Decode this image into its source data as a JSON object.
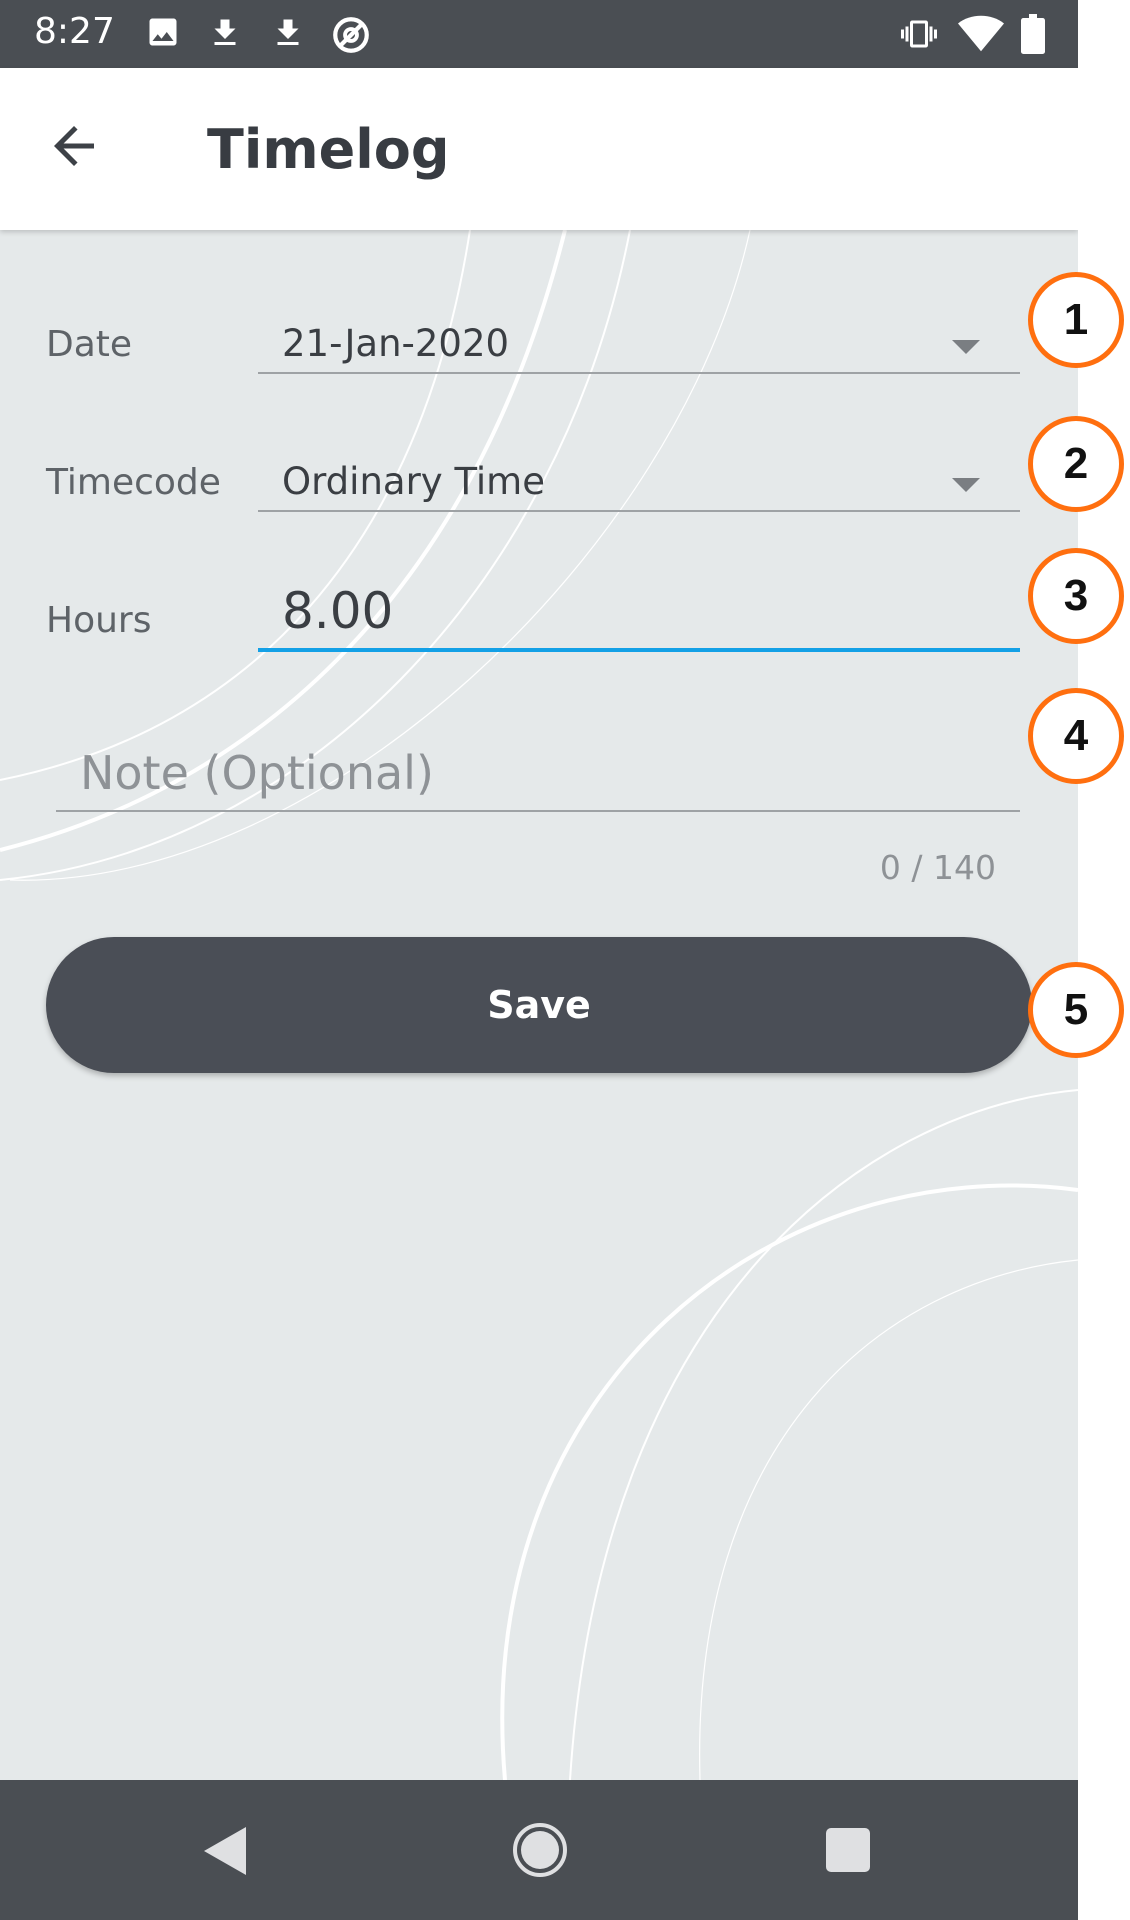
{
  "status_bar": {
    "time": "8:27",
    "left_icons": [
      "image-icon",
      "download-icon",
      "download-icon",
      "data-saver-icon"
    ],
    "right_icons": [
      "vibrate-icon",
      "wifi-icon",
      "battery-icon"
    ]
  },
  "app_bar": {
    "title": "Timelog",
    "back_icon": "arrow-back-icon"
  },
  "form": {
    "date": {
      "label": "Date",
      "value": "21-Jan-2020"
    },
    "timecode": {
      "label": "Timecode",
      "value": "Ordinary Time"
    },
    "hours": {
      "label": "Hours",
      "value": "8.00"
    },
    "note": {
      "placeholder": "Note (Optional)",
      "counter": "0 / 140"
    },
    "save_label": "Save"
  },
  "nav_bar": {
    "icons": [
      "nav-back-icon",
      "nav-home-icon",
      "nav-recents-icon"
    ]
  },
  "annotations": [
    "1",
    "2",
    "3",
    "4",
    "5"
  ],
  "colors": {
    "status_bar": "#4a4e53",
    "background": "#e5e9ea",
    "accent": "#13a0e6",
    "button": "#4a4e56",
    "annotation_ring": "#ff6f0f"
  }
}
